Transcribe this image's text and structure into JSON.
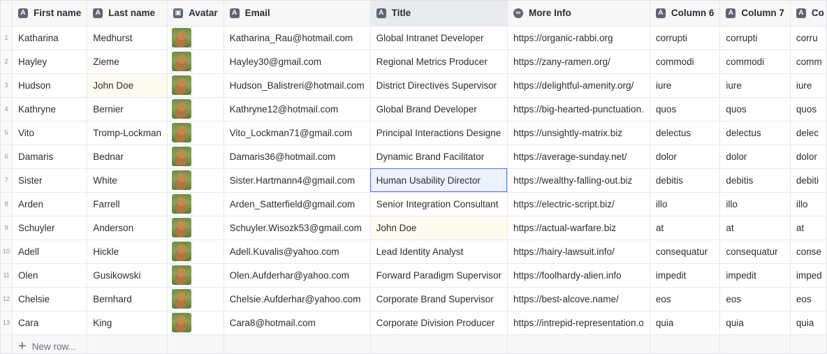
{
  "columns": [
    {
      "label": "First name",
      "icon": "text-icon"
    },
    {
      "label": "Last name",
      "icon": "text-icon"
    },
    {
      "label": "Avatar",
      "icon": "image-icon"
    },
    {
      "label": "Email",
      "icon": "text-icon"
    },
    {
      "label": "Title",
      "icon": "text-icon"
    },
    {
      "label": "More Info",
      "icon": "link-icon"
    },
    {
      "label": "Column 6",
      "icon": "text-icon"
    },
    {
      "label": "Column 7",
      "icon": "text-icon"
    },
    {
      "label": "Co",
      "icon": "text-icon"
    }
  ],
  "rows": [
    {
      "n": "1",
      "first": "Katharina",
      "last": "Medhurst",
      "email": "Katharina_Rau@hotmail.com",
      "title": "Global Intranet Developer",
      "info": "https://organic-rabbi.org",
      "c6": "corrupti",
      "c7": "corrupti",
      "c8": "corru"
    },
    {
      "n": "2",
      "first": "Hayley",
      "last": "Zieme",
      "email": "Hayley30@gmail.com",
      "title": "Regional Metrics Producer",
      "info": "https://zany-ramen.org/",
      "c6": "commodi",
      "c7": "commodi",
      "c8": "comm"
    },
    {
      "n": "3",
      "first": "Hudson",
      "last": "John Doe",
      "email": "Hudson_Balistreri@hotmail.com",
      "title": "District Directives Supervisor",
      "info": "https://delightful-amenity.org/",
      "c6": "iure",
      "c7": "iure",
      "c8": "iure"
    },
    {
      "n": "4",
      "first": "Kathryne",
      "last": "Bernier",
      "email": "Kathryne12@hotmail.com",
      "title": "Global Brand Developer",
      "info": "https://big-hearted-punctuation.",
      "c6": "quos",
      "c7": "quos",
      "c8": "quos"
    },
    {
      "n": "5",
      "first": "Vito",
      "last": "Tromp-Lockman",
      "email": "Vito_Lockman71@gmail.com",
      "title": "Principal Interactions Designe",
      "info": "https://unsightly-matrix.biz",
      "c6": "delectus",
      "c7": "delectus",
      "c8": "delec"
    },
    {
      "n": "6",
      "first": "Damaris",
      "last": "Bednar",
      "email": "Damaris36@hotmail.com",
      "title": "Dynamic Brand Facilitator",
      "info": "https://average-sunday.net/",
      "c6": "dolor",
      "c7": "dolor",
      "c8": "dolor"
    },
    {
      "n": "7",
      "first": "Sister",
      "last": "White",
      "email": "Sister.Hartmann4@gmail.com",
      "title": "Human Usability Director",
      "info": "https://wealthy-falling-out.biz",
      "c6": "debitis",
      "c7": "debitis",
      "c8": "debiti"
    },
    {
      "n": "8",
      "first": "Arden",
      "last": "Farrell",
      "email": "Arden_Satterfield@gmail.com",
      "title": "Senior Integration Consultant",
      "info": "https://electric-script.biz/",
      "c6": "illo",
      "c7": "illo",
      "c8": "illo"
    },
    {
      "n": "9",
      "first": "Schuyler",
      "last": "Anderson",
      "email": "Schuyler.Wisozk53@gmail.com",
      "title": "John Doe",
      "info": "https://actual-warfare.biz",
      "c6": "at",
      "c7": "at",
      "c8": "at"
    },
    {
      "n": "10",
      "first": "Adell",
      "last": "Hickle",
      "email": "Adell.Kuvalis@yahoo.com",
      "title": "Lead Identity Analyst",
      "info": "https://hairy-lawsuit.info/",
      "c6": "consequatur",
      "c7": "consequatur",
      "c8": "conse"
    },
    {
      "n": "11",
      "first": "Olen",
      "last": "Gusikowski",
      "email": "Olen.Aufderhar@yahoo.com",
      "title": "Forward Paradigm Supervisor",
      "info": "https://foolhardy-alien.info",
      "c6": "impedit",
      "c7": "impedit",
      "c8": "imped"
    },
    {
      "n": "12",
      "first": "Chelsie",
      "last": "Bernhard",
      "email": "Chelsie.Aufderhar@yahoo.com",
      "title": "Corporate Brand Supervisor",
      "info": "https://best-alcove.name/",
      "c6": "eos",
      "c7": "eos",
      "c8": "eos"
    },
    {
      "n": "13",
      "first": "Cara",
      "last": "King",
      "email": "Cara8@hotmail.com",
      "title": "Corporate Division Producer",
      "info": "https://intrepid-representation.o",
      "c6": "quia",
      "c7": "quia",
      "c8": "quia"
    }
  ],
  "footer": {
    "new_row_label": "New row..."
  },
  "highlights": {
    "last_name_row": "3",
    "title_row": "9",
    "focused_title_row": "7"
  },
  "colors": {
    "focus_border": "#4a6ff0",
    "highlight_bg": "#fdfbee"
  }
}
